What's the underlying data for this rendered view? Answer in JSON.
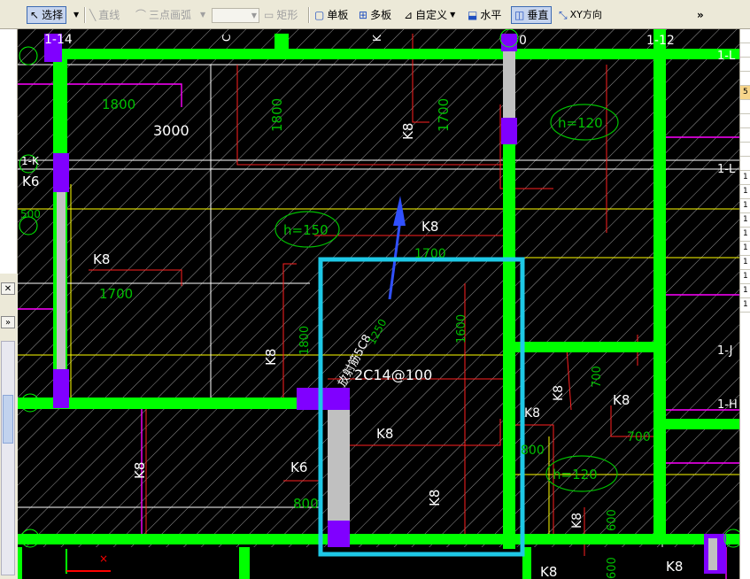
{
  "toolbar": {
    "select_label": "选择",
    "line_label": "直线",
    "arc_label": "三点画弧",
    "rect_label": "矩形",
    "single_board_label": "单板",
    "multi_board_label": "多板",
    "custom_label": "自定义",
    "horizontal_label": "水平",
    "vertical_label": "垂直",
    "xy_label": "XY方向",
    "more": "»"
  },
  "panel": {
    "close_glyph": "✕",
    "expand_glyph": "»",
    "rows": [
      "",
      "",
      "",
      "",
      "5",
      "",
      "",
      "",
      "",
      "",
      "1",
      "1",
      "1",
      "1",
      "1",
      "1",
      "1",
      "1",
      "1",
      "1"
    ]
  },
  "drawing": {
    "colors": {
      "background": "#000000",
      "hatch": "#ffffff",
      "beam": "#00ff00",
      "column": "#8000ff",
      "column_core": "#c0c0c0",
      "selection": "#1ec8e6",
      "arrow": "#3050ff",
      "rebar": "#ff2020",
      "dimension": "#00c000",
      "grid": "#ffff00",
      "magenta": "#ff00ff"
    },
    "labels": {
      "grid_1_14": "1-14",
      "grid_0": "0",
      "grid_1_12": "1-12",
      "grid_1_L_a": "1-L",
      "grid_1_L_b": "1-L",
      "grid_1_J": "1-J",
      "grid_1_H": "1-H",
      "grid_1_K": "1-K",
      "dim_1800_a": "1800",
      "dim_3000": "3000",
      "dim_1800_b": "1800",
      "k8_top": "K8",
      "dim_1700_top": "1700",
      "h120_top": "h=120",
      "k6_left": "K6",
      "h150": "h=150",
      "k8_center": "K8",
      "dim_1700_center": "1700",
      "k8_left": "K8",
      "dim_1700_left": "1700",
      "k8_vert": "K8",
      "dim_1800_vert": "1800",
      "rebar_note": "放射筋5C8",
      "dim_1250": "1250",
      "dim_1600": "1600",
      "rebar_2c14": "2C14@100",
      "k8_mid": "K8",
      "k8_right": "K8",
      "dim_700_a": "700",
      "k8_right2": "K8",
      "dim_700_b": "700",
      "k8_right3": "K8",
      "k8_lower": "K8",
      "k6_lower": "K6",
      "dim_800_a": "800",
      "k8_lower_vert": "K8",
      "k8_bottom_vert": "K8",
      "dim_800_b": "800",
      "h120_bottom": "h=120",
      "k8_lowright": "K8",
      "dim_600": "600",
      "k8_bot1": "K8",
      "k8_bot2": "K8",
      "dim_600_b": "600",
      "dim_500": "500",
      "top_c": "C",
      "top_k": "K"
    }
  }
}
